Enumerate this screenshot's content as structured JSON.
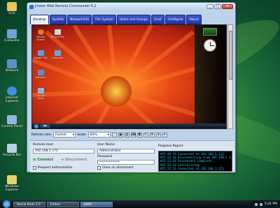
{
  "window": {
    "title": "Jimber Web Remote Commander 6.2"
  },
  "tabs": [
    {
      "label": "Desktop"
    },
    {
      "label": "SysInfo"
    },
    {
      "label": "NetworkInfo"
    },
    {
      "label": "File System"
    },
    {
      "label": "Users and Groups"
    },
    {
      "label": "Chat"
    },
    {
      "label": "Configure"
    },
    {
      "label": "About"
    }
  ],
  "desktop_icons": [
    {
      "label": "Live",
      "icon": "folder-icon",
      "color": "#e8c65a"
    },
    {
      "label": "Computer",
      "icon": "computer-icon",
      "color": "#6fa3d8"
    },
    {
      "label": "Network",
      "icon": "network-icon",
      "color": "#5d8fc7"
    },
    {
      "label": "Internet Explorer",
      "icon": "ie-icon",
      "color": "#3d8fe0"
    },
    {
      "label": "Control Panel",
      "icon": "control-panel-icon",
      "color": "#8fb6e0"
    },
    {
      "label": "Recycle Bin",
      "icon": "recycle-bin-icon",
      "color": "#b8d0e0"
    },
    {
      "label": "Windows Explorer",
      "icon": "explorer-icon",
      "color": "#e8d46a"
    }
  ],
  "remote_icons": [
    {
      "label": "Mozilla Firefox",
      "icon": "firefox-icon",
      "color": "#e8782a"
    },
    {
      "label": "Recycle Bin",
      "icon": "recycle-bin-icon",
      "color": "#cfd8e0"
    },
    {
      "label": "Google Talk",
      "icon": "chat-icon",
      "color": "#5a9ae0"
    },
    {
      "label": "Computer",
      "icon": "computer-icon",
      "color": "#6fa3d8"
    },
    {
      "label": "Network",
      "icon": "network-icon",
      "color": "#5d8fc7"
    },
    {
      "label": "Control Panel",
      "icon": "control-panel-icon",
      "color": "#8fb6e0"
    }
  ],
  "toolbar": {
    "refresh_label": "Refresh rate:",
    "refresh_value": "Fastest",
    "scale_label": "Scale:",
    "scale_value": "60%"
  },
  "panel": {
    "remote_host_label": "Remote Host",
    "remote_host_value": "192.168.1.171",
    "username_label": "User Name",
    "username_value": "Administrator",
    "password_label": "Password",
    "password_value": "•••••••••••",
    "connect_label": "Connect",
    "disconnect_label": "Disconnect",
    "request_auth_label": "Request authorization",
    "clear_label": "Clear on disconnect",
    "progress_label": "Progress Report",
    "progress_lines": [
      "#15:49:19 Connected to 192.168.1.112",
      "#15:52:14 Disconnecting from 192.168.1.112. Please wait.",
      "#15:52:19 Disconnect complete.",
      "#15:52:31 Initializing...",
      "#15:52:33 Connected to 192.168.1.171"
    ]
  },
  "taskbar": {
    "items": [
      {
        "label": "Social Beat 2.0"
      },
      {
        "label": "Jimber"
      },
      {
        "label": "JWRC"
      }
    ],
    "time": "5:41 PM"
  },
  "colors": {
    "accent": "#2035a8",
    "progress_text": "#1fd7ee"
  }
}
